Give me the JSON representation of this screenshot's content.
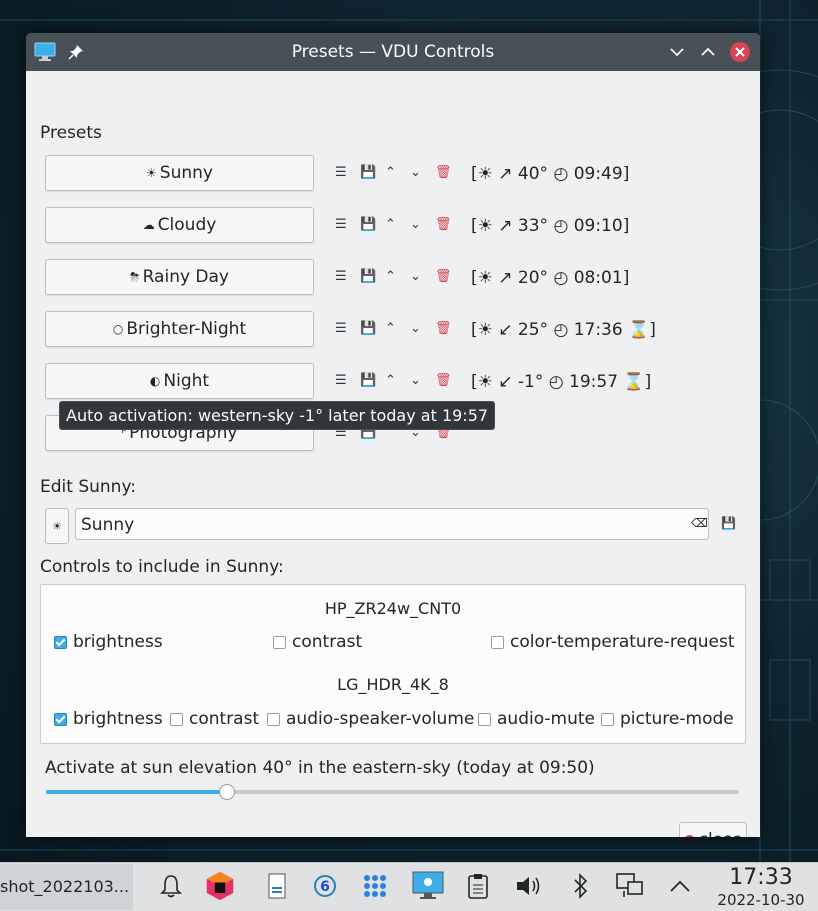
{
  "window": {
    "title": "Presets — VDU Controls",
    "section_label": "Presets"
  },
  "presets": [
    {
      "icon": "☀",
      "name": "Sunny",
      "schedule": "[☀ ↗ 40° ◴ 09:49]"
    },
    {
      "icon": "☁",
      "name": "Cloudy",
      "schedule": "[☀ ↗ 33° ◴ 09:10]"
    },
    {
      "icon": "⛈",
      "name": "Rainy Day",
      "schedule": "[☀ ↗ 20° ◴ 08:01]"
    },
    {
      "icon": "○",
      "name": "Brighter-Night",
      "schedule": "[☀ ↙ 25° ◴ 17:36 ⌛]"
    },
    {
      "icon": "◐",
      "name": "Night",
      "schedule": "[☀ ↙ -1° ◴ 19:57 ⌛]"
    },
    {
      "icon": "ᴾ",
      "name": "Photography",
      "schedule": ""
    }
  ],
  "tooltip": "Auto activation: western-sky -1° later today at 19:57",
  "edit": {
    "label": "Edit Sunny:",
    "icon": "☀",
    "name_value": "Sunny"
  },
  "controls": {
    "label": "Controls to include in Sunny:",
    "vdus": [
      {
        "name": "HP_ZR24w_CNT0",
        "items": [
          {
            "label": "brightness",
            "checked": true
          },
          {
            "label": "contrast",
            "checked": false
          },
          {
            "label": "color-temperature-request",
            "checked": false
          }
        ]
      },
      {
        "name": "LG_HDR_4K_8",
        "items": [
          {
            "label": "brightness",
            "checked": true
          },
          {
            "label": "contrast",
            "checked": false
          },
          {
            "label": "audio-speaker-volume",
            "checked": false
          },
          {
            "label": "audio-mute",
            "checked": false
          },
          {
            "label": "picture-mode",
            "checked": false
          }
        ]
      }
    ]
  },
  "activation": {
    "text": "Activate at sun elevation 40° in the eastern-sky (today at 09:50)",
    "slider_fraction": 0.26
  },
  "close_label": "close",
  "taskbar": {
    "task_label": "shot_2022103...",
    "time": "17:33",
    "date": "2022-10-30"
  },
  "colors": {
    "accent": "#3daee9",
    "delete": "#da4453",
    "titlebar": "#475057"
  }
}
